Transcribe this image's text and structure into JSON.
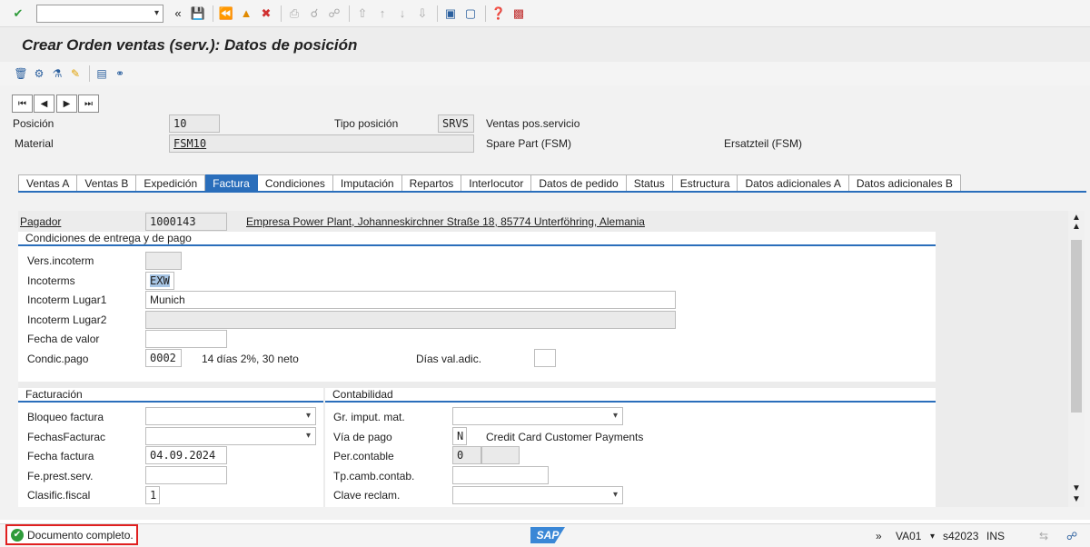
{
  "toolbar": {
    "command_field": "",
    "icons": [
      "enter-icon",
      "back-icon",
      "exit-icon",
      "cancel-icon",
      "save-icon",
      "print-icon",
      "find-icon",
      "find-next-icon",
      "first-page-icon",
      "prev-page-icon",
      "next-page-icon",
      "last-page-icon",
      "new-session-icon",
      "shortcut-icon",
      "help-icon",
      "layout-icon"
    ]
  },
  "title": "Crear Orden ventas (serv.): Datos de posición",
  "header": {
    "posicion_label": "Posición",
    "posicion_value": "10",
    "tipo_posicion_label": "Tipo posición",
    "tipo_posicion_value": "SRVS",
    "tipo_posicion_desc": "Ventas pos.servicio",
    "material_label": "Material",
    "material_value": "FSM10",
    "material_desc": "Spare Part (FSM)",
    "material_desc2": "Ersatzteil (FSM)"
  },
  "tabs": [
    {
      "label": "Ventas A"
    },
    {
      "label": "Ventas B"
    },
    {
      "label": "Expedición"
    },
    {
      "label": "Factura",
      "active": true
    },
    {
      "label": "Condiciones"
    },
    {
      "label": "Imputación"
    },
    {
      "label": "Repartos"
    },
    {
      "label": "Interlocutor"
    },
    {
      "label": "Datos de pedido"
    },
    {
      "label": "Status"
    },
    {
      "label": "Estructura"
    },
    {
      "label": "Datos adicionales A"
    },
    {
      "label": "Datos adicionales B"
    }
  ],
  "pagador": {
    "label": "Pagador",
    "value": "1000143",
    "desc": "Empresa Power Plant, Johanneskirchner Straße 18, 85774 Unterföhring, Alemania"
  },
  "condiciones": {
    "title": "Condiciones de entrega y de pago",
    "vers_incoterm_label": "Vers.incoterm",
    "vers_incoterm_value": "",
    "incoterms_label": "Incoterms",
    "incoterms_value": "EXW",
    "lugar1_label": "Incoterm Lugar1",
    "lugar1_value": "Munich",
    "lugar2_label": "Incoterm Lugar2",
    "lugar2_value": "",
    "fecha_valor_label": "Fecha de valor",
    "fecha_valor_value": "",
    "condic_pago_label": "Condic.pago",
    "condic_pago_value": "0002",
    "condic_pago_desc": "14 días 2%, 30 neto",
    "dias_val_label": "Días val.adic.",
    "dias_val_value": ""
  },
  "facturacion": {
    "title": "Facturación",
    "bloqueo_label": "Bloqueo factura",
    "bloqueo_value": "",
    "fechas_label": "FechasFacturac",
    "fechas_value": "",
    "fecha_factura_label": "Fecha factura",
    "fecha_factura_value": "04.09.2024",
    "fe_prest_label": "Fe.prest.serv.",
    "fe_prest_value": "",
    "clasif_label": "Clasific.fiscal",
    "clasif_value": "1"
  },
  "contabilidad": {
    "title": "Contabilidad",
    "gr_imput_label": "Gr. imput. mat.",
    "gr_imput_value": "",
    "via_pago_label": "Vía de pago",
    "via_pago_value": "N",
    "via_pago_desc": "Credit Card Customer Payments",
    "per_contable_label": "Per.contable",
    "per_contable_value": "0",
    "per_contable_value2": "",
    "tp_camb_label": "Tp.camb.contab.",
    "tp_camb_value": "",
    "clave_reclam_label": "Clave reclam.",
    "clave_reclam_value": ""
  },
  "status": {
    "message": "Documento completo.",
    "transaction": "VA01",
    "server": "s42023",
    "mode": "INS",
    "logo": "SAP"
  }
}
